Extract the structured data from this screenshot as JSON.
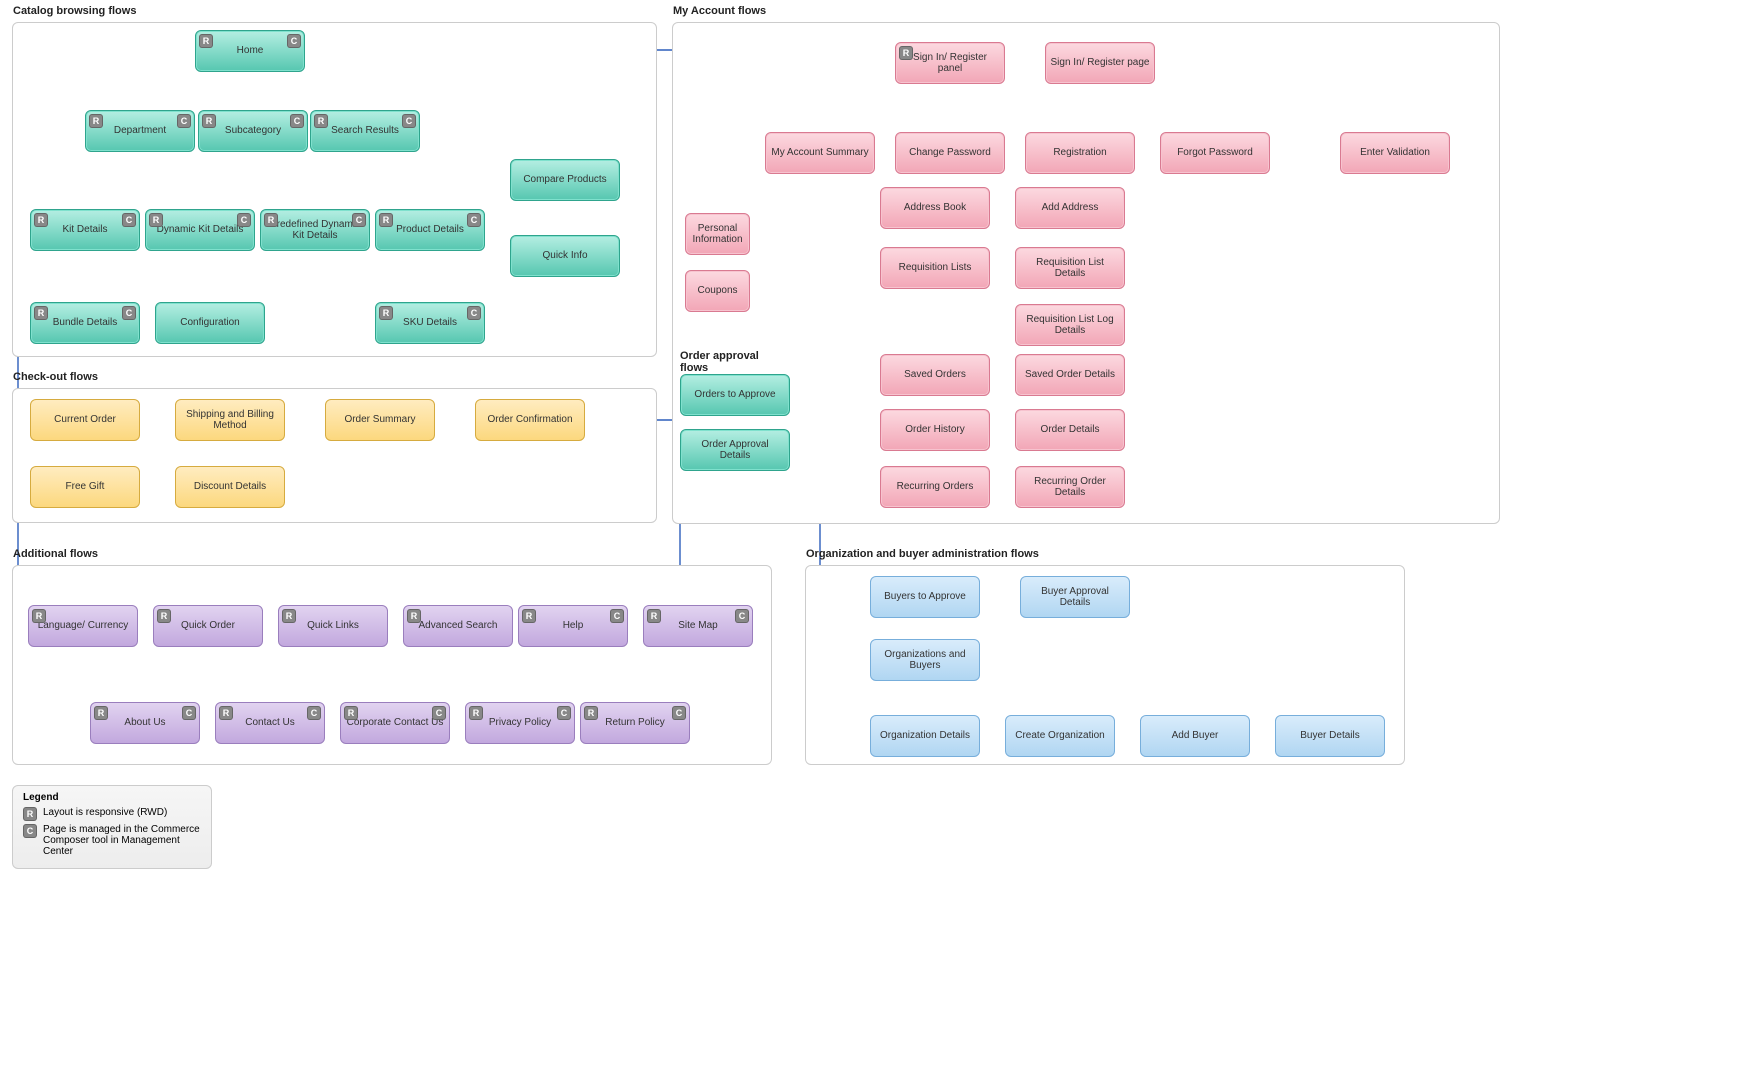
{
  "sections": {
    "catalog": {
      "title": "Catalog browsing flows"
    },
    "checkout": {
      "title": "Check-out flows"
    },
    "additional": {
      "title": "Additional flows"
    },
    "account": {
      "title": "My Account flows"
    },
    "approval": {
      "title": "Order approval flows"
    },
    "org": {
      "title": "Organization and buyer administration flows"
    }
  },
  "catalog": {
    "home": "Home",
    "department": "Department",
    "subcategory": "Subcategory",
    "search_results": "Search Results",
    "compare": "Compare Products",
    "quick_info": "Quick Info",
    "kit_details": "Kit Details",
    "dyn_kit": "Dynamic Kit Details",
    "predef_kit": "Predefined Dynamic Kit Details",
    "product_details": "Product Details",
    "bundle": "Bundle Details",
    "configuration": "Configuration",
    "sku": "SKU Details"
  },
  "checkout": {
    "current_order": "Current Order",
    "ship_bill": "Shipping and Billing Method",
    "order_summary": "Order Summary",
    "order_conf": "Order Confirmation",
    "free_gift": "Free Gift",
    "discount": "Discount Details"
  },
  "additional": {
    "lang": "Language/ Currency",
    "quick_order": "Quick Order",
    "quick_links": "Quick Links",
    "adv_search": "Advanced Search",
    "help": "Help",
    "sitemap": "Site Map",
    "about": "About Us",
    "contact": "Contact Us",
    "corp_contact": "Corporate Contact Us",
    "privacy": "Privacy Policy",
    "return": "Return Policy"
  },
  "account": {
    "signin_panel": "Sign In/ Register panel",
    "signin_page": "Sign In/ Register page",
    "summary": "My Account Summary",
    "change_pw": "Change Password",
    "registration": "Registration",
    "forgot_pw": "Forgot Password",
    "enter_val": "Enter Validation",
    "address_book": "Address Book",
    "add_address": "Add Address",
    "personal": "Personal Information",
    "req_lists": "Requisition Lists",
    "req_list_details": "Requisition List Details",
    "req_log": "Requisition List Log Details",
    "coupons": "Coupons",
    "saved_orders": "Saved Orders",
    "saved_order_details": "Saved Order Details",
    "order_history": "Order History",
    "order_details": "Order Details",
    "recurring": "Recurring Orders",
    "recurring_details": "Recurring Order Details"
  },
  "approval": {
    "orders_to_approve": "Orders to Approve",
    "approval_details": "Order Approval Details"
  },
  "org": {
    "buyers_to_approve": "Buyers to Approve",
    "buyer_approval": "Buyer Approval Details",
    "orgs_buyers": "Organizations and Buyers",
    "org_details": "Organization Details",
    "create_org": "Create Organization",
    "add_buyer": "Add Buyer",
    "buyer_details": "Buyer Details"
  },
  "legend": {
    "title": "Legend",
    "r": "Layout is responsive (RWD)",
    "c": "Page is managed in the Commerce Composer tool in Management Center"
  },
  "badges": {
    "r": "R",
    "c": "C"
  }
}
